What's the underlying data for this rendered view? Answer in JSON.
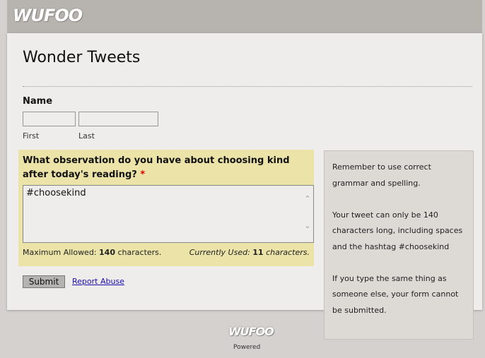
{
  "header": {
    "logo": "WUFOO"
  },
  "form": {
    "title": "Wonder Tweets",
    "name_field": {
      "label": "Name",
      "first_label": "First",
      "last_label": "Last",
      "first_value": "",
      "last_value": ""
    },
    "question": {
      "label": "What observation do you have about choosing kind after today's reading?",
      "required_mark": "*",
      "value": "#choosekind",
      "max_label": "Maximum Allowed:",
      "max_value": "140",
      "max_unit": "characters.",
      "used_label": "Currently Used:",
      "used_value": "11",
      "used_unit": "characters."
    },
    "submit_label": "Submit",
    "report_abuse_label": "Report Abuse"
  },
  "instructions": {
    "p1": "Remember to use correct grammar and spelling.",
    "p2": "Your tweet can only be 140 characters long, including spaces and the hashtag #choosekind",
    "p3": "If you type the same thing as someone else, your form cannot be submitted."
  },
  "footer": {
    "logo": "WUFOO",
    "powered": "Powered"
  },
  "colors": {
    "page_bg": "#d4d1ce",
    "header_bg": "#b7b3af",
    "form_bg": "#eeedec",
    "highlight_bg": "#ece3a8",
    "instructions_bg": "#ddd9d5",
    "link": "#1a0dab",
    "required": "#dd0000"
  },
  "icons": {
    "scroll_up": "chevron-up-icon",
    "scroll_down": "chevron-down-icon"
  }
}
